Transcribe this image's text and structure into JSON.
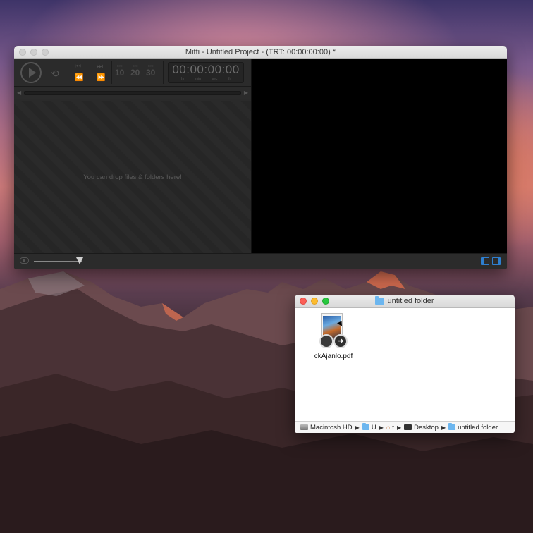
{
  "mitti": {
    "title": "Mitti - Untitled Project - (TRT: 00:00:00:00) *",
    "timecode": "00:00:00:00",
    "tc_units": [
      "hr",
      "min",
      "sec",
      "fr"
    ],
    "fps_buttons": [
      {
        "label": "sec",
        "value": "10"
      },
      {
        "label": "sec",
        "value": "20"
      },
      {
        "label": "sec",
        "value": "30"
      }
    ],
    "drop_hint": "You can drop files & folders here!"
  },
  "finder": {
    "title": "untitled folder",
    "file_name": "ckAjanlo.pdf",
    "path": [
      "Macintosh HD",
      "U",
      "t",
      "Desktop",
      "untitled folder"
    ]
  },
  "colors": {
    "accent": "#2e7fd0",
    "folder": "#6cb6ef"
  }
}
